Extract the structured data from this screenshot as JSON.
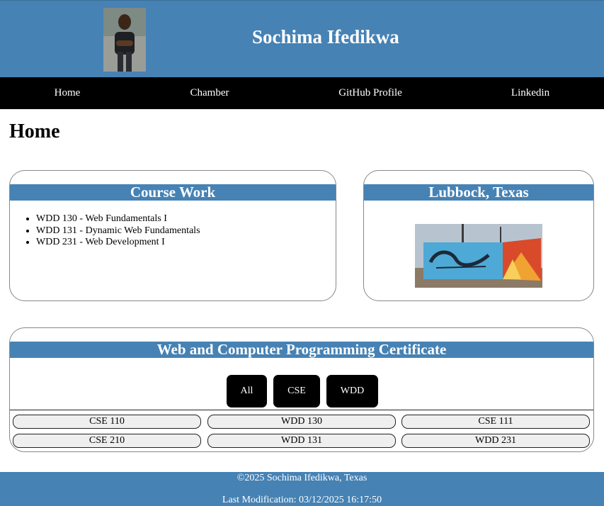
{
  "header": {
    "name": "Sochima Ifedikwa"
  },
  "nav": {
    "items": [
      "Home",
      "Chamber",
      "GitHub Profile",
      "Linkedin"
    ]
  },
  "main": {
    "heading": "Home"
  },
  "course_work": {
    "title": "Course Work",
    "items": [
      "WDD 130 - Web Fundamentals I",
      "WDD 131 - Dynamic Web Fundamentals",
      "WDD 231 - Web Development I"
    ]
  },
  "location": {
    "title": "Lubbock, Texas"
  },
  "certificate": {
    "title": "Web and Computer Programming Certificate",
    "filters": [
      "All",
      "CSE",
      "WDD"
    ],
    "courses": [
      "CSE 110",
      "WDD 130",
      "CSE 111",
      "CSE 210",
      "WDD 131",
      "WDD 231"
    ]
  },
  "footer": {
    "copyright": "©2025 Sochima Ifedikwa, Texas",
    "last_modified": "Last Modification: 03/12/2025 16:17:50"
  },
  "colors": {
    "brand_blue": "#4682b4",
    "nav_black": "#000000"
  }
}
